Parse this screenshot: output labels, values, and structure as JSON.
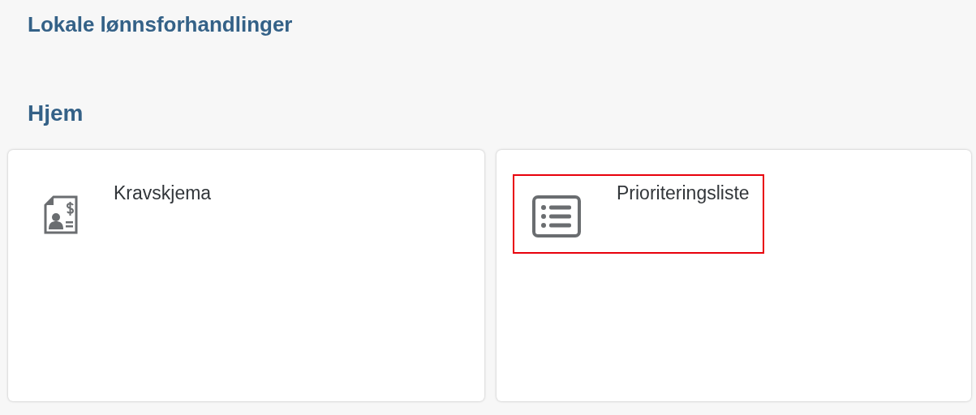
{
  "app_title": "Lokale lønnsforhandlinger",
  "page_title": "Hjem",
  "tiles": [
    {
      "kind": "claim",
      "label": "Kravskjema",
      "highlighted": false
    },
    {
      "kind": "list",
      "label": "Prioriteringsliste",
      "highlighted": true
    }
  ]
}
